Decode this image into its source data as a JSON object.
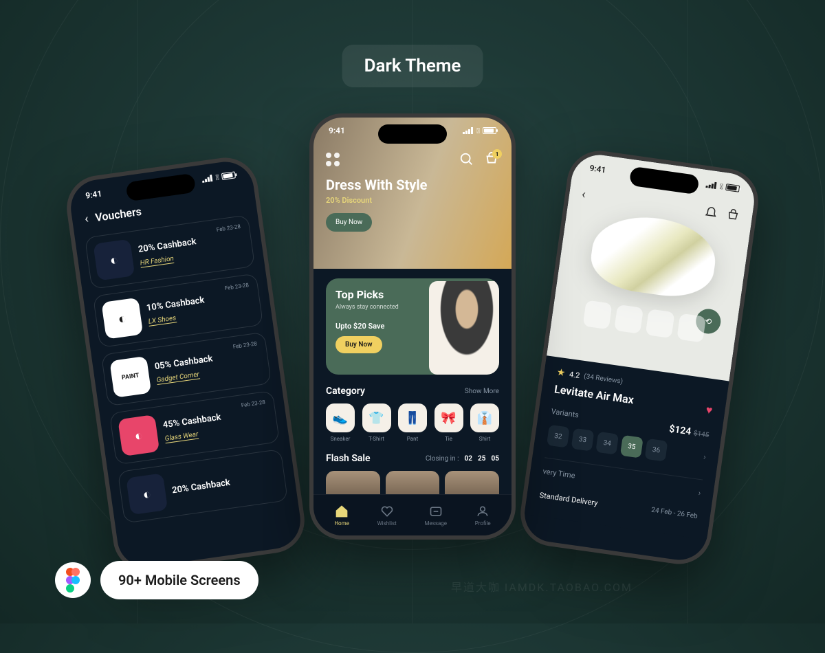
{
  "header": {
    "title": "Dark Theme"
  },
  "footer": {
    "screens": "90+ Mobile Screens"
  },
  "status": {
    "time": "9:41"
  },
  "vouchers": {
    "title": "Vouchers",
    "items": [
      {
        "deal": "20% Cashback",
        "brand": "HR Fashion",
        "date": "Feb 23-28",
        "logoBg": "#17223a",
        "logoText": ""
      },
      {
        "deal": "10% Cashback",
        "brand": "LX Shoes",
        "date": "Feb 23-28",
        "logoBg": "#fff",
        "logoText": ""
      },
      {
        "deal": "05% Cashback",
        "brand": "Gadget Corner",
        "date": "Feb 23-28",
        "logoBg": "#fff",
        "logoText": "PAINT"
      },
      {
        "deal": "45% Cashback",
        "brand": "Glass Wear",
        "date": "Feb 23-28",
        "logoBg": "#e8456a",
        "logoText": ""
      },
      {
        "deal": "20% Cashback",
        "brand": "",
        "date": "",
        "logoBg": "#17223a",
        "logoText": ""
      }
    ]
  },
  "home": {
    "heroTitle": "Dress With Style",
    "heroSub": "20% Discount",
    "heroBtn": "Buy Now",
    "cartBadge": "1",
    "topPicks": {
      "title": "Top Picks",
      "sub": "Always stay connected",
      "save": "Upto $20 Save",
      "btn": "Buy Now"
    },
    "category": {
      "title": "Category",
      "more": "Show More",
      "items": [
        {
          "icon": "👟",
          "label": "Sneaker"
        },
        {
          "icon": "👕",
          "label": "T-Shirt"
        },
        {
          "icon": "👖",
          "label": "Pant"
        },
        {
          "icon": "🎀",
          "label": "Tie"
        },
        {
          "icon": "👔",
          "label": "Shirt"
        }
      ]
    },
    "flashSale": {
      "title": "Flash Sale",
      "closingLabel": "Closing in :",
      "timer": [
        "02",
        "25",
        "05"
      ]
    },
    "tabs": [
      {
        "label": "Home",
        "active": true
      },
      {
        "label": "Wishlist",
        "active": false
      },
      {
        "label": "Message",
        "active": false
      },
      {
        "label": "Profile",
        "active": false
      }
    ]
  },
  "product": {
    "rating": "4.2",
    "reviews": "(34 Reviews)",
    "name": "Levitate Air Max",
    "variantsLabel": "Variants",
    "price": "$124",
    "priceOld": "$145",
    "sizes": [
      "32",
      "33",
      "34",
      "35",
      "36"
    ],
    "activeSize": "35",
    "deliveryLabel": "very Time",
    "deliveryName": "Standard Delivery",
    "deliveryDate": "24 Feb - 26 Feb"
  },
  "watermark": "早道大咖 IAMDK.TAOBAO.COM"
}
